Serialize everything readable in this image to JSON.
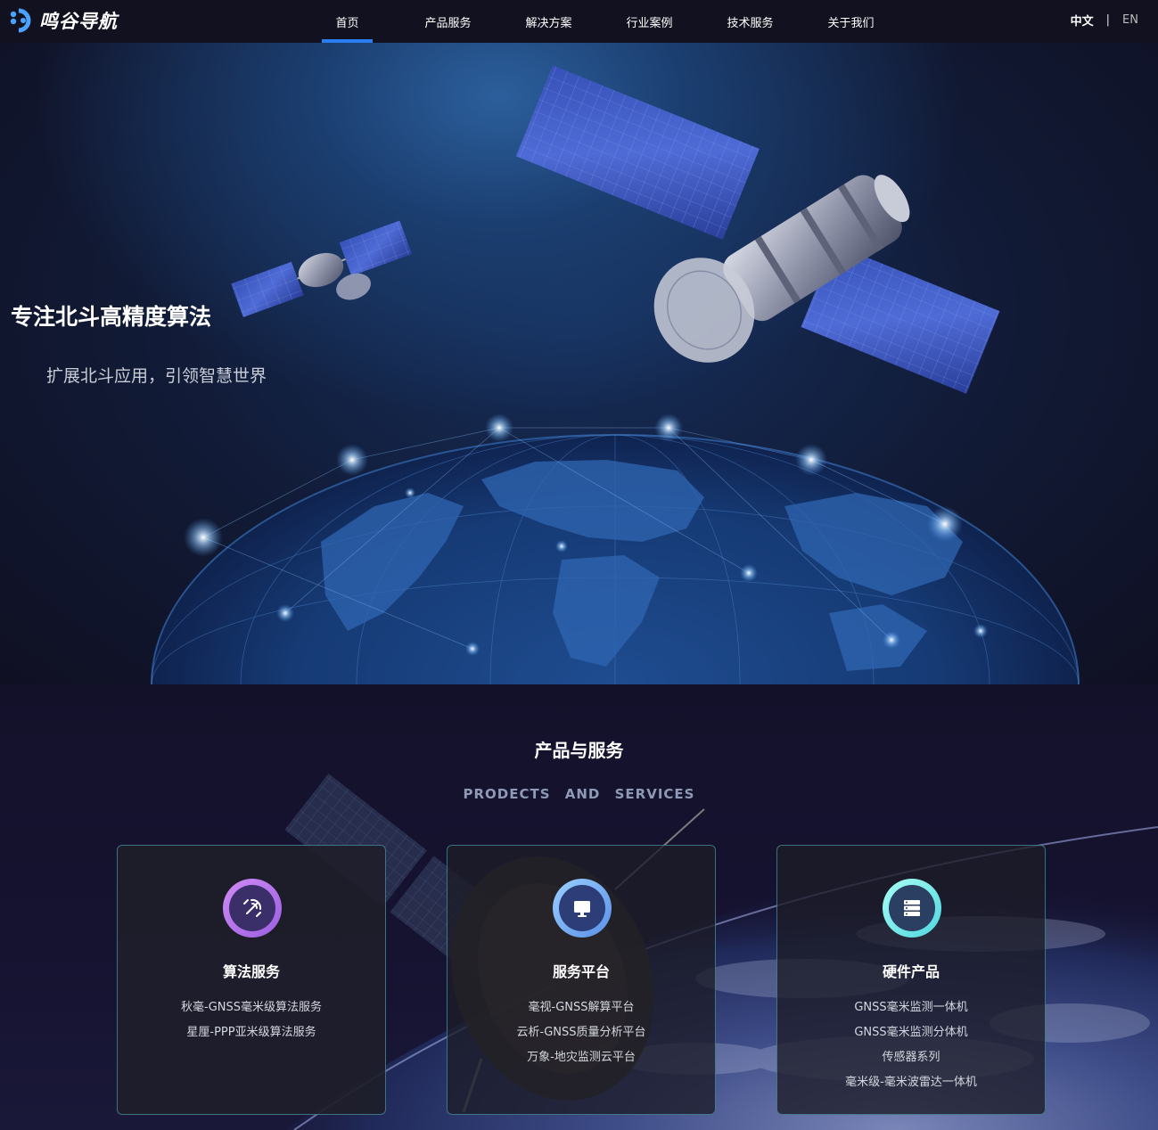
{
  "nav": {
    "logo_text": "鸣谷导航",
    "items": [
      {
        "label": "首页",
        "active": true
      },
      {
        "label": "产品服务"
      },
      {
        "label": "解决方案"
      },
      {
        "label": "行业案例"
      },
      {
        "label": "技术服务"
      },
      {
        "label": "关于我们"
      }
    ],
    "lang_cn": "中文",
    "lang_sep": "|",
    "lang_en": "EN",
    "accent_color": "#2c7ef0"
  },
  "hero": {
    "title": "专注北斗高精度算法",
    "subtitle": "扩展北斗应用，引领智慧世界"
  },
  "products": {
    "title": "产品与服务",
    "subtitle": "PRODECTS AND SERVICES",
    "cards": [
      {
        "icon": "satellite-icon",
        "title": "算法服务",
        "items": [
          "秋毫-GNSS毫米级算法服务",
          "星厘-PPP亚米级算法服务"
        ]
      },
      {
        "icon": "monitor-icon",
        "title": "服务平台",
        "items": [
          "毫视-GNSS解算平台",
          "云析-GNSS质量分析平台",
          "万象-地灾监测云平台"
        ]
      },
      {
        "icon": "server-icon",
        "title": "硬件产品",
        "items": [
          "GNSS毫米监测一体机",
          "GNSS毫米监测分体机",
          "传感器系列",
          "毫米级-毫米波雷达一体机"
        ]
      }
    ]
  }
}
